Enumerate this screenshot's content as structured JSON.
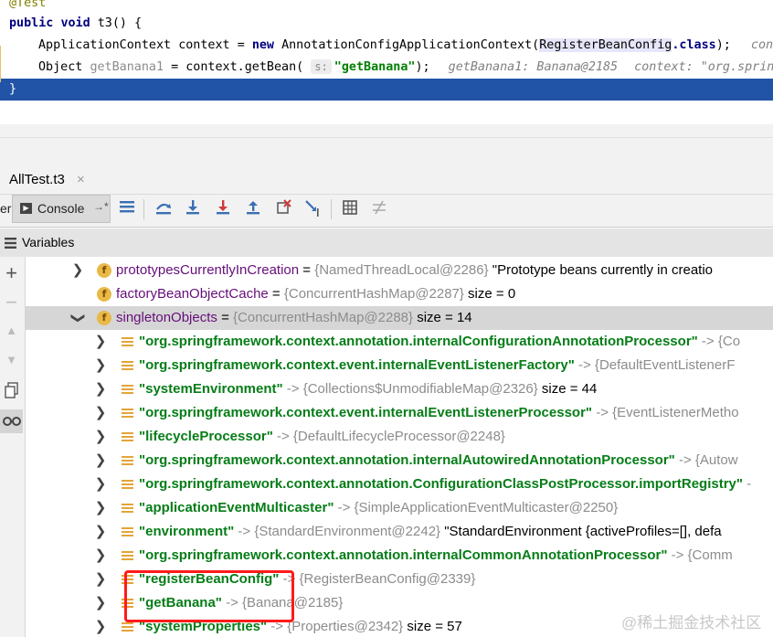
{
  "editor": {
    "lines": [
      {
        "annotation": "@Test"
      },
      {
        "kw": "public",
        "kw2": "void",
        "name": "t3() {"
      },
      {
        "type": "ApplicationContext",
        "var": "context",
        "eq": "=",
        "kw": "new",
        "ctor": "AnnotationConfigApplicationContext(",
        "arg": "RegisterBeanConfig",
        "dot_class": ".class",
        "end": ");",
        "hint": "conte"
      },
      {
        "type": "Object",
        "var": "getBanana1",
        "eq": "= context.getBean(",
        "param": "s:",
        "str": "\"getBanana\"",
        "end": ");",
        "hint1": "getBanana1: Banana@2185",
        "hint2": "context: \"org.springf"
      },
      {
        "text": "}"
      }
    ],
    "current_line_color": "#2154a6"
  },
  "debug_tab": {
    "title": "AllTest.t3",
    "close": "×"
  },
  "toolbar": {
    "left_fragment": "er",
    "console_label": "Console",
    "console_icon": "▶",
    "console_arrow": "→*",
    "icons": [
      "list-icon",
      "step-over-icon",
      "step-into-icon",
      "force-step-into-icon",
      "step-out-icon",
      "drop-frame-icon",
      "run-to-cursor-icon",
      "evaluate-icon",
      "trace-icon"
    ]
  },
  "variables_panel": {
    "title": "Variables",
    "rows": [
      {
        "kind": "field",
        "chev": "›",
        "name": "prototypesCurrentlyInCreation",
        "op": " = ",
        "ref": "{NamedThreadLocal@2286}",
        "extra": " \"Prototype beans currently in creatio"
      },
      {
        "kind": "field",
        "chev": "",
        "name": "factoryBeanObjectCache",
        "op": " = ",
        "ref": "{ConcurrentHashMap@2287}",
        "extra": "  size = 0"
      },
      {
        "kind": "field",
        "chev": "⌄",
        "name": "singletonObjects",
        "op": " = ",
        "ref": "{ConcurrentHashMap@2288}",
        "extra": "  size = 14",
        "selected": true
      },
      {
        "kind": "entry",
        "key": "\"org.springframework.context.annotation.internalConfigurationAnnotationProcessor\"",
        "ref": " -> {Co"
      },
      {
        "kind": "entry",
        "key": "\"org.springframework.context.event.internalEventListenerFactory\"",
        "ref": " -> {DefaultEventListenerF"
      },
      {
        "kind": "entry",
        "key": "\"systemEnvironment\"",
        "ref": " -> {Collections$UnmodifiableMap@2326}",
        "extra": "  size = 44"
      },
      {
        "kind": "entry",
        "key": "\"org.springframework.context.event.internalEventListenerProcessor\"",
        "ref": " -> {EventListenerMetho"
      },
      {
        "kind": "entry",
        "key": "\"lifecycleProcessor\"",
        "ref": " -> {DefaultLifecycleProcessor@2248}"
      },
      {
        "kind": "entry",
        "key": "\"org.springframework.context.annotation.internalAutowiredAnnotationProcessor\"",
        "ref": " -> {Autow"
      },
      {
        "kind": "entry",
        "key": "\"org.springframework.context.annotation.ConfigurationClassPostProcessor.importRegistry\"",
        "ref": " -"
      },
      {
        "kind": "entry",
        "key": "\"applicationEventMulticaster\"",
        "ref": " -> {SimpleApplicationEventMulticaster@2250}"
      },
      {
        "kind": "entry",
        "key": "\"environment\"",
        "ref": " -> {StandardEnvironment@2242}",
        "extra": " \"StandardEnvironment {activeProfiles=[], defa"
      },
      {
        "kind": "entry",
        "key": "\"org.springframework.context.annotation.internalCommonAnnotationProcessor\"",
        "ref": " -> {Comm"
      },
      {
        "kind": "entry",
        "key": "\"registerBeanConfig\"",
        "ref": " -> {RegisterBeanConfig@2339}"
      },
      {
        "kind": "entry",
        "key": "\"getBanana\"",
        "ref": " -> {Banana@2185}"
      },
      {
        "kind": "entry",
        "key": "\"systemProperties\"",
        "ref": " -> {Properties@2342}",
        "extra": "  size = 57"
      }
    ]
  },
  "left_strip_icons": [
    "plus-icon",
    "minus-icon",
    "up-icon",
    "down-icon",
    "copy-icon",
    "glasses-icon"
  ],
  "watermark": "@稀土掘金技术社区"
}
